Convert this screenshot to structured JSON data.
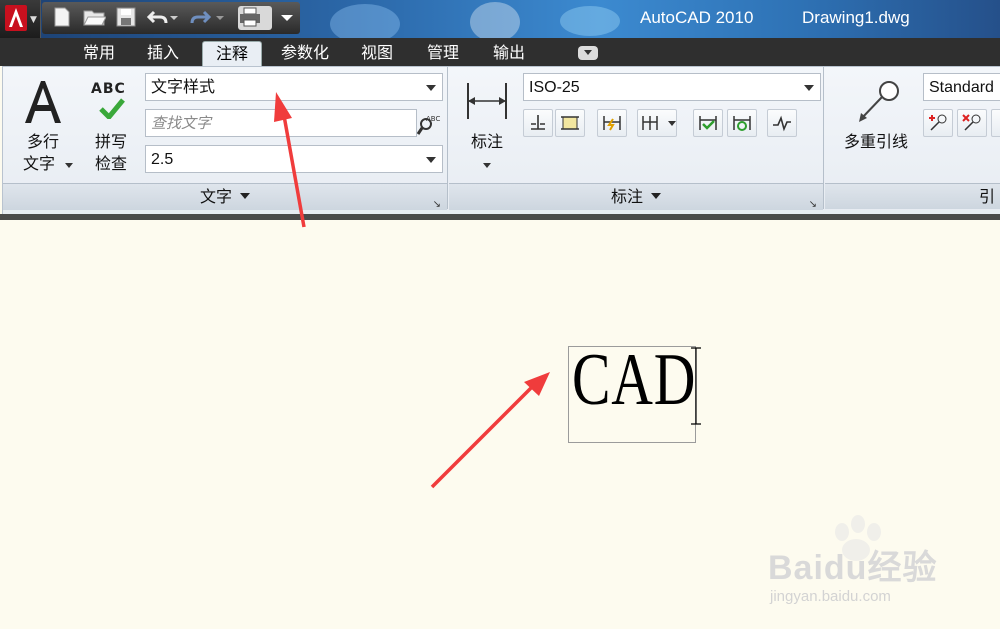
{
  "window": {
    "app_title": "AutoCAD 2010",
    "file_name": "Drawing1.dwg"
  },
  "quick_access": {
    "icons": [
      "new-file-icon",
      "open-folder-icon",
      "save-icon",
      "undo-icon",
      "redo-icon",
      "plot-icon",
      "qat-dropdown-icon"
    ]
  },
  "tabs": [
    {
      "label": "常用",
      "active": false
    },
    {
      "label": "插入",
      "active": false
    },
    {
      "label": "注释",
      "active": true
    },
    {
      "label": "参数化",
      "active": false
    },
    {
      "label": "视图",
      "active": false
    },
    {
      "label": "管理",
      "active": false
    },
    {
      "label": "输出",
      "active": false
    }
  ],
  "text_panel": {
    "mtext_label_line1": "多行",
    "mtext_label_line2": "文字",
    "spell_icon_text": "ABC",
    "spell_label_line1": "拼写",
    "spell_label_line2": "检查",
    "style_value": "文字样式",
    "search_placeholder": "查找文字",
    "height_value": "2.5",
    "footer": "文字"
  },
  "dim_panel": {
    "dim_label": "标注",
    "style_value": "ISO-25",
    "footer": "标注"
  },
  "leader_panel": {
    "label": "多重引线",
    "style_value": "Standard",
    "footer": "引"
  },
  "drawing": {
    "mtext_content": "CAD"
  },
  "watermark": {
    "brand": "Baidu经验",
    "url": "jingyan.baidu.com"
  },
  "colors": {
    "annotation_arrow": "#f03c3c",
    "canvas_bg": "#fdfbef",
    "ribbon_bg": "#eef2f7"
  }
}
